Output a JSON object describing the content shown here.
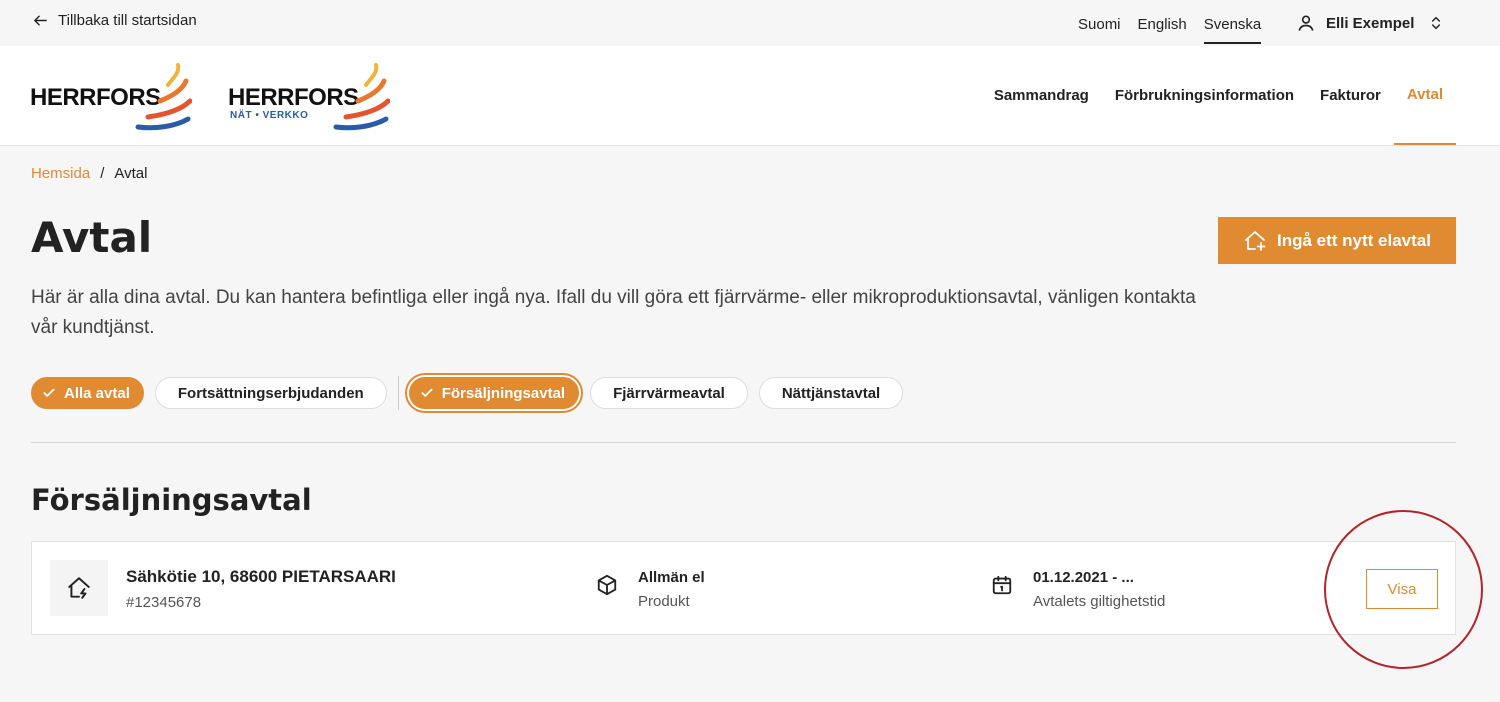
{
  "topbar": {
    "back_label": "Tillbaka till startsidan",
    "languages": [
      "Suomi",
      "English",
      "Svenska"
    ],
    "active_language": "Svenska",
    "user_name": "Elli Exempel"
  },
  "header": {
    "logo1": {
      "word": "HERRFORS",
      "sub": ""
    },
    "logo2": {
      "word": "HERRFORS",
      "sub": "NÄT • VERKKO"
    },
    "nav": [
      "Sammandrag",
      "Förbrukningsinformation",
      "Fakturor",
      "Avtal"
    ],
    "active_nav": "Avtal"
  },
  "breadcrumb": {
    "home": "Hemsida",
    "separator": "/",
    "current": "Avtal"
  },
  "page": {
    "title": "Avtal",
    "new_button": "Ingå ett nytt elavtal",
    "intro": "Här är alla dina avtal. Du kan hantera befintliga eller ingå nya. Ifall du vill göra ett fjärrvärme- eller mikroproduktionsavtal, vänligen kontakta vår kundtjänst."
  },
  "filters": {
    "all": "Alla avtal",
    "continuation": "Fortsättningserbjudanden",
    "sales": "Försäljningsavtal",
    "district_heating": "Fjärrvärmeavtal",
    "network": "Nättjänstavtal"
  },
  "section": {
    "title": "Försäljningsavtal"
  },
  "contract": {
    "address": "Sähkötie 10, 68600 PIETARSAARI",
    "number": "#12345678",
    "product_value": "Allmän el",
    "product_label": "Produkt",
    "validity_value": "01.12.2021 - ...",
    "validity_label": "Avtalets giltighetstid",
    "view_button": "Visa"
  },
  "colors": {
    "accent": "#e08a32",
    "annotation": "#b3252a",
    "logo_blue": "#2a5aa8"
  }
}
